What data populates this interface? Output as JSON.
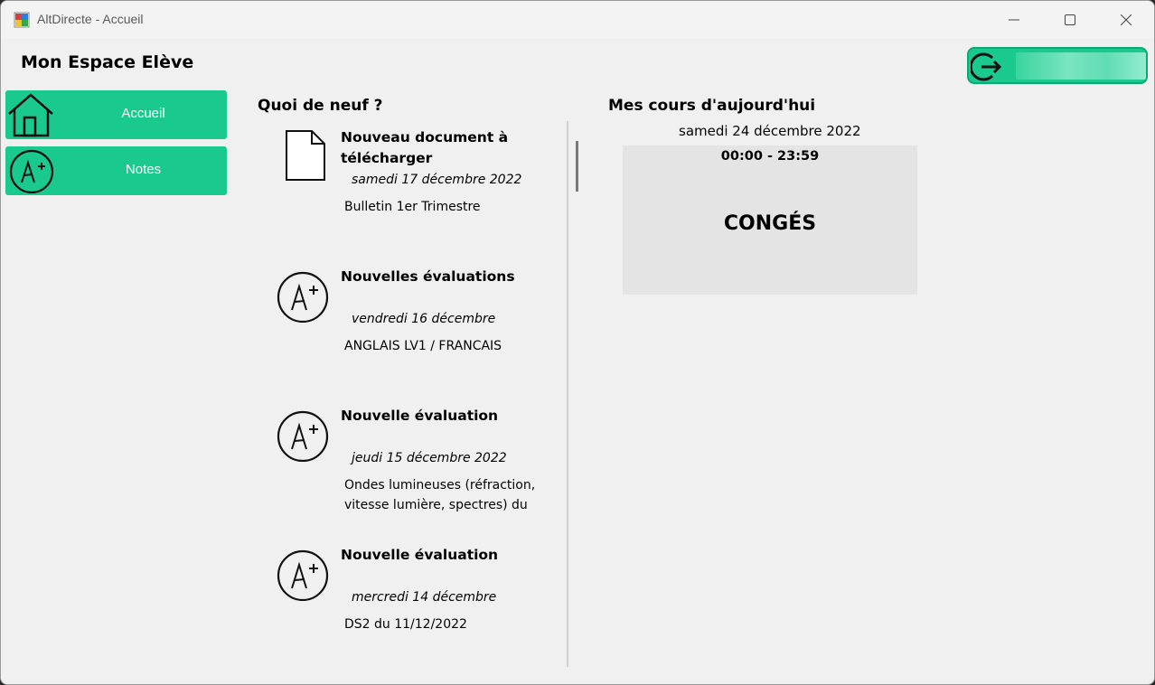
{
  "window": {
    "title": "AltDirecte - Accueil"
  },
  "header": {
    "page_title": "Mon Espace Elève",
    "logout_icon": "logout-icon"
  },
  "sidebar": {
    "items": [
      {
        "label": "Accueil",
        "icon": "house-icon"
      },
      {
        "label": "Notes",
        "icon": "grade-a-plus-icon"
      }
    ]
  },
  "news": {
    "title": "Quoi de neuf ?",
    "items": [
      {
        "icon": "document-icon",
        "heading": "Nouveau document à télécharger",
        "date": "samedi 17 décembre 2022",
        "description": "Bulletin 1er Trimestre"
      },
      {
        "icon": "grade-a-plus-icon",
        "heading": "Nouvelles évaluations",
        "date": "vendredi 16 décembre",
        "description": "ANGLAIS LV1 / FRANCAIS"
      },
      {
        "icon": "grade-a-plus-icon",
        "heading": "Nouvelle évaluation",
        "date": "jeudi 15 décembre 2022",
        "description": "Ondes lumineuses (réfraction, vitesse lumière, spectres) du"
      },
      {
        "icon": "grade-a-plus-icon",
        "heading": "Nouvelle évaluation",
        "date": "mercredi 14 décembre",
        "description": "DS2 du 11/12/2022"
      }
    ]
  },
  "schedule": {
    "title": "Mes cours d'aujourd'hui",
    "date": "samedi 24 décembre 2022",
    "time": "00:00 - 23:59",
    "label": "CONGÉS"
  },
  "colors": {
    "accent": "#19c98d",
    "card": "#e4e4e4",
    "background": "#f0f0f0"
  }
}
